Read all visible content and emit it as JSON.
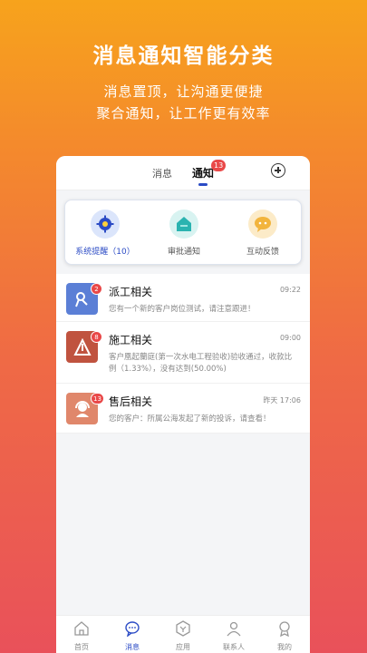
{
  "promo": {
    "title": "消息通知智能分类",
    "subtitle_line1": "消息置顶，让沟通更便捷",
    "subtitle_line2": "聚合通知，让工作更有效率"
  },
  "tabs": {
    "messages": "消息",
    "notifications": "通知",
    "notifications_badge": "13"
  },
  "categories": [
    {
      "label": "系统提醒（10）",
      "icon": "gear-icon",
      "color": "#2b4bc5"
    },
    {
      "label": "审批通知",
      "icon": "house-icon",
      "color": "#2ab3b0"
    },
    {
      "label": "互动反馈",
      "icon": "chat-bubble-icon",
      "color": "#f2b43c"
    }
  ],
  "messages": [
    {
      "title": "派工相关",
      "time": "09:22",
      "text": "您有一个新的客户岗位测试，请注意跟进！",
      "badge": "2",
      "color": "#5b7fd6",
      "icon": "dispatch-icon"
    },
    {
      "title": "施工相关",
      "time": "09:00",
      "text": "客户凰起蘭庭(第一次水电工程验收)验收通过，收款比例（1.33%），没有达到(50.00%)",
      "badge": "8",
      "color": "#c0533f",
      "icon": "construction-icon"
    },
    {
      "title": "售后相关",
      "time": "昨天 17:06",
      "text": "您的客户：所属公海发起了新的投诉，请查看！",
      "badge": "13",
      "color": "#e0876b",
      "icon": "support-headset-icon"
    }
  ],
  "navbar": [
    {
      "label": "首页",
      "icon": "home-icon"
    },
    {
      "label": "消息",
      "icon": "message-icon"
    },
    {
      "label": "应用",
      "icon": "apps-icon"
    },
    {
      "label": "联系人",
      "icon": "contacts-icon"
    },
    {
      "label": "我的",
      "icon": "profile-icon"
    }
  ],
  "colors": {
    "accent": "#2b4bc5",
    "badge": "#e94848"
  }
}
